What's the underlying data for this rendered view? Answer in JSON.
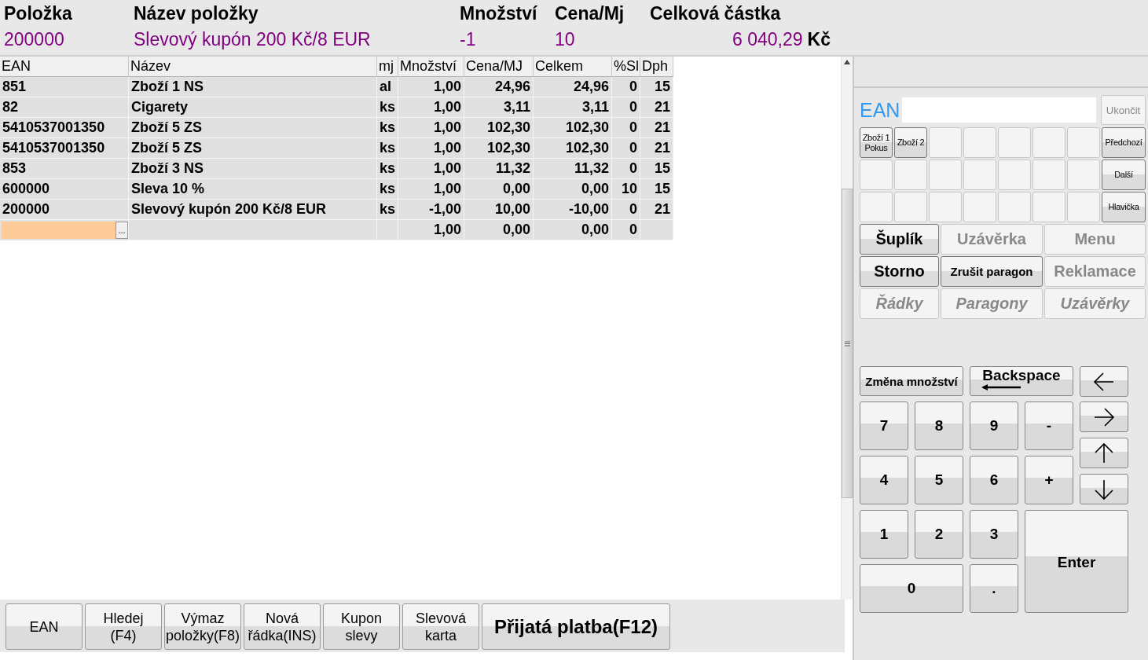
{
  "header": {
    "columns": [
      {
        "label": "Položka",
        "value": "200000"
      },
      {
        "label": "Název položky",
        "value": "Slevový kupón 200 Kč/8 EUR"
      },
      {
        "label": "Množství",
        "value": "-1"
      },
      {
        "label": "Cena/Mj",
        "value": "10"
      },
      {
        "label": "Celková částka",
        "value": "6 040,29",
        "unit": "Kč"
      }
    ]
  },
  "table": {
    "columns": [
      "EAN",
      "Název",
      "mj",
      "Množství",
      "Cena/MJ",
      "Celkem",
      "%Sl",
      "Dph"
    ],
    "rows": [
      {
        "cells": [
          "851",
          "Zboží 1 NS",
          "al",
          "1,00",
          "24,96",
          "24,96",
          "0",
          "15"
        ]
      },
      {
        "cells": [
          "82",
          "Cigarety",
          "ks",
          "1,00",
          "3,11",
          "3,11",
          "0",
          "21"
        ]
      },
      {
        "cells": [
          "5410537001350",
          "Zboží 5 ZS",
          "ks",
          "1,00",
          "102,30",
          "102,30",
          "0",
          "21"
        ]
      },
      {
        "cells": [
          "5410537001350",
          "Zboží 5 ZS",
          "ks",
          "1,00",
          "102,30",
          "102,30",
          "0",
          "21"
        ]
      },
      {
        "cells": [
          "853",
          "Zboží 3 NS",
          "ks",
          "1,00",
          "11,32",
          "11,32",
          "0",
          "15"
        ]
      },
      {
        "cells": [
          "600000",
          "Sleva 10 %",
          "ks",
          "1,00",
          "0,00",
          "0,00",
          "10",
          "15"
        ]
      },
      {
        "cells": [
          "200000",
          "Slevový kupón 200 Kč/8 EUR",
          "ks",
          "-1,00",
          "10,00",
          "-10,00",
          "0",
          "21"
        ]
      }
    ],
    "new_row": {
      "picker": "...",
      "cells": [
        "",
        "",
        "",
        "1,00",
        "0,00",
        "0,00",
        "0",
        ""
      ]
    }
  },
  "toolbar": [
    {
      "label": "EAN",
      "primary": false
    },
    {
      "label": "Hledej\n(F4)",
      "primary": false
    },
    {
      "label": "Výmaz\npoložky(F8)",
      "primary": false
    },
    {
      "label": "Nová\nřádka(INS)",
      "primary": false
    },
    {
      "label": "Kupon\nslevy",
      "primary": false
    },
    {
      "label": "Slevová\nkarta",
      "primary": false
    },
    {
      "label": "Přijatá platba(F12)",
      "primary": true
    }
  ],
  "ean": {
    "label": "EAN",
    "exit": "Ukončit"
  },
  "items": [
    {
      "label": "Zboží 1\nPokus"
    },
    {
      "label": "Zboží 2"
    }
  ],
  "pager": [
    {
      "label": "Předchozí"
    },
    {
      "label": "Další"
    },
    {
      "label": "Hlavička"
    }
  ],
  "actions": [
    {
      "label": "Šuplík",
      "kind": "command",
      "disabled": false
    },
    {
      "label": "Uzávěrka",
      "kind": "command",
      "disabled": true
    },
    {
      "label": "Menu",
      "kind": "command",
      "disabled": true
    },
    {
      "label": "Storno",
      "kind": "command",
      "disabled": false
    },
    {
      "label": "Zrušit paragon",
      "kind": "command",
      "disabled": false
    },
    {
      "label": "Reklamace",
      "kind": "command",
      "disabled": true
    },
    {
      "label": "Řádky",
      "kind": "view",
      "disabled": true
    },
    {
      "label": "Paragony",
      "kind": "view",
      "disabled": true
    },
    {
      "label": "Uzávěrky",
      "kind": "view",
      "disabled": true
    }
  ],
  "keypad": {
    "quantity": "Změna množství",
    "backspace": "Backspace",
    "enter": "Enter",
    "keys": [
      "7",
      "8",
      "9",
      "-",
      "4",
      "5",
      "6",
      "+",
      "1",
      "2",
      "3",
      "0",
      "."
    ]
  }
}
